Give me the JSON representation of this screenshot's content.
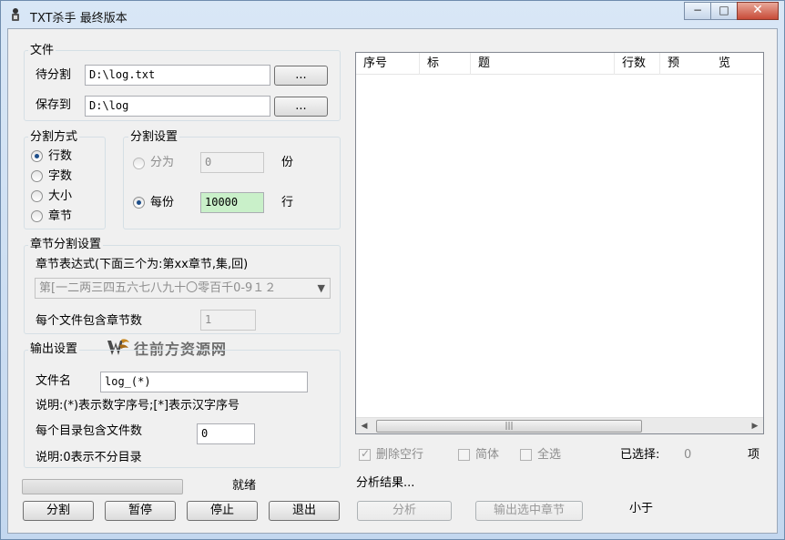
{
  "window": {
    "title": "TXT杀手 最终版本",
    "controls": {
      "minimize": "−",
      "maximize": "□",
      "close": "✕"
    }
  },
  "file_group": {
    "label": "文件",
    "source_label": "待分割",
    "source_value": "D:\\log.txt",
    "dest_label": "保存到",
    "dest_value": "D:\\log",
    "browse_label": "..."
  },
  "split_mode": {
    "label": "分割方式",
    "options": [
      "行数",
      "字数",
      "大小",
      "章节"
    ],
    "selected": "行数"
  },
  "split_settings": {
    "label": "分割设置",
    "divide_label": "分为",
    "divide_value": "0",
    "divide_unit": "份",
    "each_label": "每份",
    "each_value": "10000",
    "each_unit": "行"
  },
  "chapter_settings": {
    "label": "章节分割设置",
    "expr_label": "章节表达式(下面三个为:第xx章节,集,回)",
    "expr_value": "第[一二两三四五六七八九十〇零百千0-9１２",
    "per_file_label": "每个文件包含章节数",
    "per_file_value": "1"
  },
  "watermark": {
    "text": "往前方资源网",
    "icon": "w-logo-icon"
  },
  "output_settings": {
    "label": "输出设置",
    "filename_label": "文件名",
    "filename_value": "log_(*)",
    "filename_note": "说明:(*)表示数字序号;[*]表示汉字序号",
    "per_dir_label": "每个目录包含文件数",
    "per_dir_value": "0",
    "per_dir_note": "说明:0表示不分目录"
  },
  "status": {
    "text": "就绪",
    "progress": 0
  },
  "actions": {
    "split": "分割",
    "pause": "暂停",
    "stop": "停止",
    "exit": "退出"
  },
  "list": {
    "columns": [
      "序号",
      "标",
      "题",
      "行数",
      "预",
      "览"
    ]
  },
  "options": {
    "remove_blank": "删除空行",
    "simplified": "简体",
    "select_all": "全选",
    "selected_label": "已选择:",
    "selected_count": "0",
    "selected_unit": "项"
  },
  "analysis": {
    "result_label": "分析结果...",
    "analyze_button": "分析",
    "export_button": "输出选中章节",
    "size_note": "小于"
  }
}
